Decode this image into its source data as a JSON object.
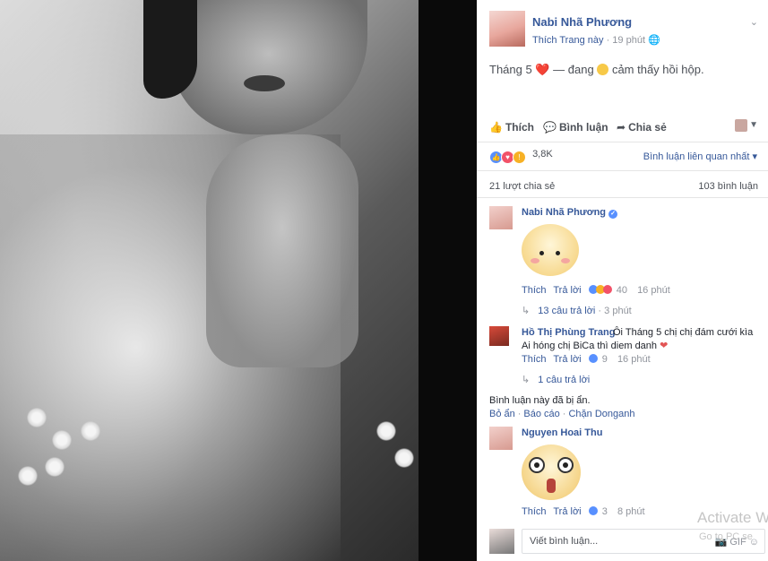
{
  "post": {
    "page_name": "Nabi Nhã Phương",
    "like_page": "Thích Trang này",
    "time": "19 phút",
    "dot": "·",
    "text_before": "Tháng 5",
    "text_middle": "— đang",
    "text_after": "cảm thấy hồi hộp.",
    "heart": "❤️"
  },
  "actions": {
    "like": "Thích",
    "comment": "Bình luận",
    "share": "Chia sẻ"
  },
  "reactions": {
    "count": "3,8K",
    "sort": "Bình luận liên quan nhất"
  },
  "counts": {
    "shares": "21 lượt chia sẻ",
    "comments": "103 bình luận"
  },
  "comments": [
    {
      "name": "Nabi Nhã Phương",
      "like": "Thích",
      "reply": "Trả lời",
      "reaction_count": "40",
      "time": "16 phút",
      "replies_label": "13 câu trả lời",
      "replies_time": "3 phút"
    },
    {
      "name": "Hồ Thị Phùng Trang",
      "text": "Ôi Tháng 5 chị chị đám cưới kìa Ai hóng chị BiCa thì diem danh",
      "like": "Thích",
      "reply": "Trả lời",
      "reaction_count": "9",
      "time": "16 phút",
      "replies_label": "1 câu trả lời"
    },
    {
      "name": "Nguyen Hoai Thu",
      "like": "Thích",
      "reply": "Trả lời",
      "reaction_count": "3",
      "time": "8 phút"
    }
  ],
  "hidden": {
    "note": "Bình luận này đã bị ẩn.",
    "unhide": "Bỏ ẩn",
    "report": "Báo cáo",
    "block": "Chặn Donganh"
  },
  "composer": {
    "placeholder": "Viết bình luận..."
  },
  "watermark": {
    "line1": "Activate W",
    "line2": "Go to PC se"
  },
  "colors": {
    "link": "#365899",
    "heart": "#e25555",
    "like": "#5890ff",
    "love": "#f25268",
    "wow": "#f7b125"
  }
}
